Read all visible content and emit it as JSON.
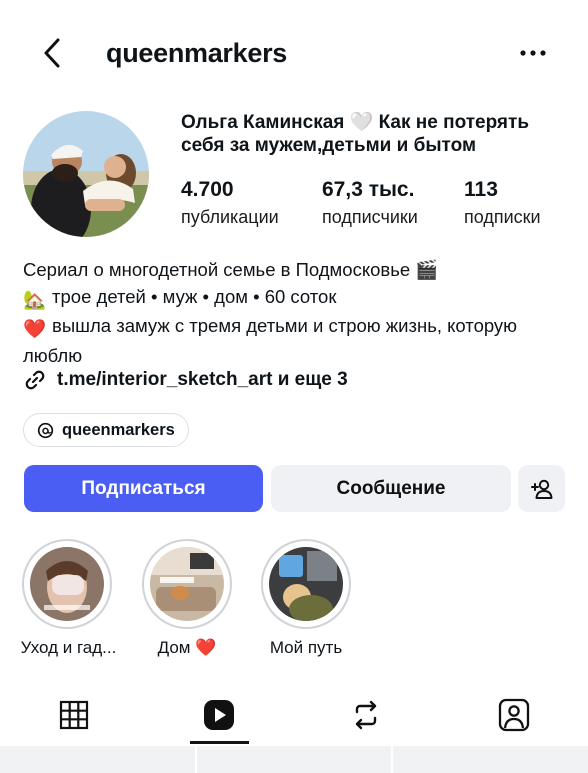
{
  "header": {
    "username": "queenmarkers",
    "back_icon": "chevron-left-icon",
    "more_icon": "more-horizontal-icon"
  },
  "profile": {
    "display_name": "Ольга Каминская 🤍 Как не потерять себя за мужем,детьми и бытом",
    "stats": [
      {
        "value": "4.700",
        "label": "публикации"
      },
      {
        "value": "67,3 тыс.",
        "label": "подписчики"
      },
      {
        "value": "113",
        "label": "подписки"
      }
    ]
  },
  "bio": {
    "line1": "Сериал о многодетной семье в Подмосковье",
    "line1_emoji": "🎬",
    "line2_emoji": "🏡",
    "line2": "трое детей • муж • дом • 60 соток",
    "line3_emoji": "❤️",
    "line3": "вышла замуж с тремя детьми и строю жизнь, которую люблю",
    "link": "t.me/interior_sketch_art и еще 3",
    "link_icon": "link-icon"
  },
  "threads": {
    "label": "queenmarkers",
    "icon": "threads-icon"
  },
  "actions": {
    "follow_label": "Подписаться",
    "message_label": "Сообщение",
    "add_user_icon": "add-person-icon",
    "follow_color": "#4a5ef4"
  },
  "highlights": [
    {
      "label": "Уход и гад..."
    },
    {
      "label": "Дом ❤️"
    },
    {
      "label": "Мой путь"
    }
  ],
  "tabs": [
    {
      "icon": "grid-icon"
    },
    {
      "icon": "reels-icon"
    },
    {
      "icon": "repost-icon"
    },
    {
      "icon": "tagged-icon"
    }
  ]
}
